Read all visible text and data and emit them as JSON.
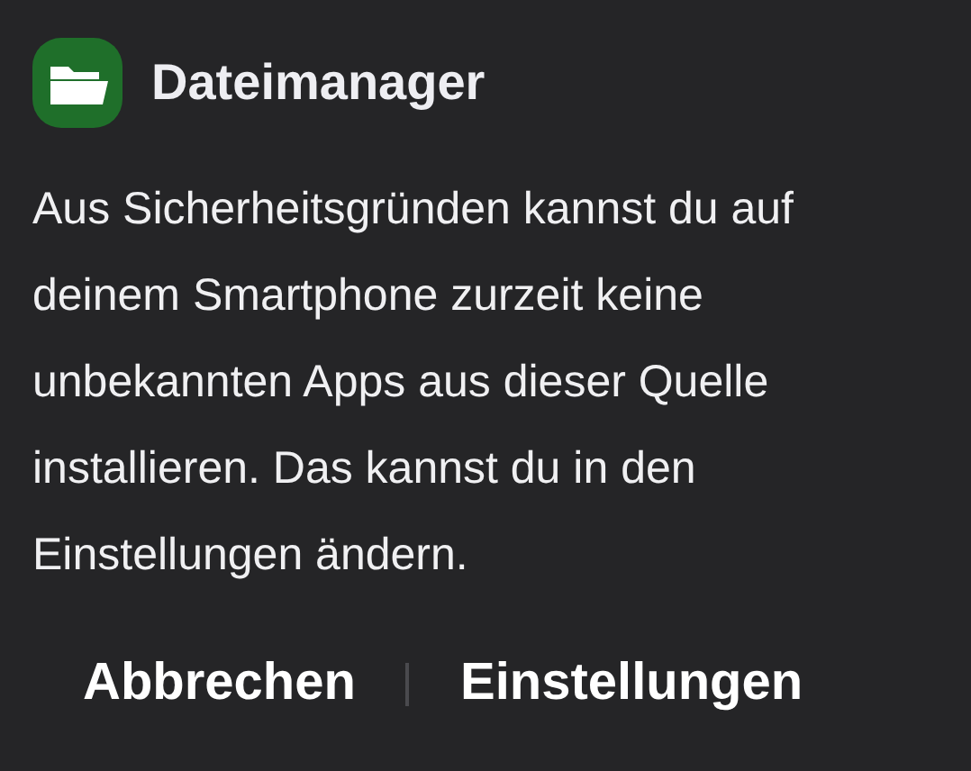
{
  "dialog": {
    "app_name": "Dateimanager",
    "message": "Aus Sicherheitsgründen kannst du auf deinem Smartphone zurzeit keine unbekannten Apps aus dieser Quelle installieren. Das kannst du in den Einstellungen ändern.",
    "buttons": [
      {
        "label": "Abbrechen"
      },
      {
        "label": "Einstellungen"
      }
    ]
  }
}
